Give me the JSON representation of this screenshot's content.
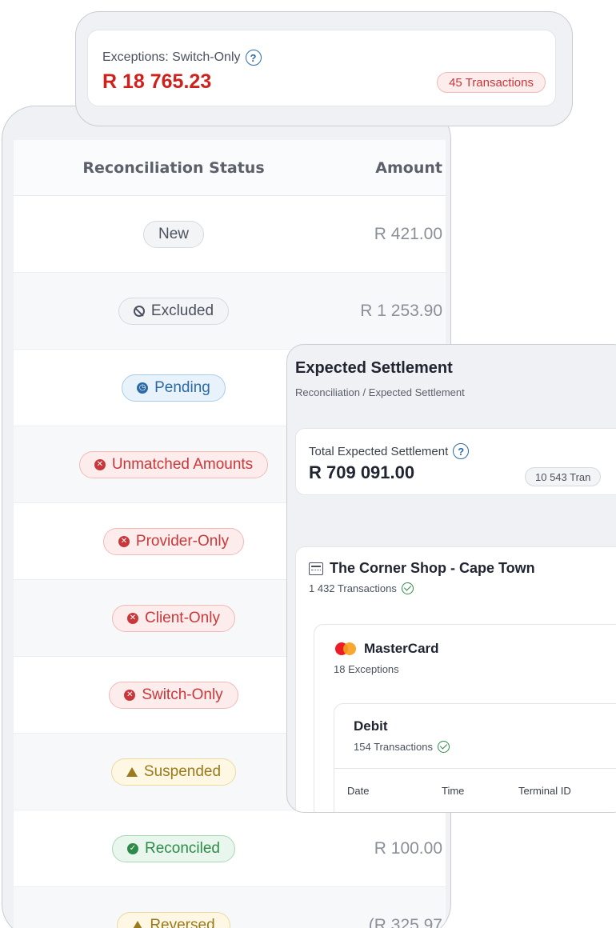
{
  "exceptions_card": {
    "label": "Exceptions: Switch-Only",
    "help_icon": "question-circle-icon",
    "amount": "R 18 765.23",
    "transactions_badge": "45 Transactions",
    "amount_color": "#d0201c"
  },
  "status_table": {
    "headers": {
      "status": "Reconciliation Status",
      "amount": "Amount"
    },
    "rows": [
      {
        "status": "New",
        "amount": "R 421.00"
      },
      {
        "status": "Excluded",
        "amount": "R 1 253.90"
      },
      {
        "status": "Pending",
        "amount": ""
      },
      {
        "status": "Unmatched Amounts",
        "amount": ""
      },
      {
        "status": "Provider-Only",
        "amount": ""
      },
      {
        "status": "Client-Only",
        "amount": ""
      },
      {
        "status": "Switch-Only",
        "amount": ""
      },
      {
        "status": "Suspended",
        "amount": ""
      },
      {
        "status": "Reconciled",
        "amount": "R 100.00"
      },
      {
        "status": "Reversed",
        "amount": "(R 325.97"
      }
    ]
  },
  "settlement": {
    "title": "Expected Settlement",
    "breadcrumb": "Reconciliation / Expected Settlement",
    "total_label": "Total Expected Settlement",
    "total_amount": "R 709 091.00",
    "total_badge": "10 543 Tran",
    "shop": {
      "name": "The Corner Shop - Cape Town",
      "transactions": "1 432 Transactions"
    },
    "card_scheme": {
      "name": "MasterCard",
      "exceptions": "18 Exceptions"
    },
    "debit": {
      "title": "Debit",
      "transactions": "154 Transactions",
      "columns": [
        "Date",
        "Time",
        "Terminal ID"
      ]
    }
  },
  "status_colors": {
    "neutral": "#4b5160",
    "pending": "#2c6aa6",
    "error": "#c8383b",
    "warning": "#9a7a1c",
    "success": "#2e8a49"
  }
}
